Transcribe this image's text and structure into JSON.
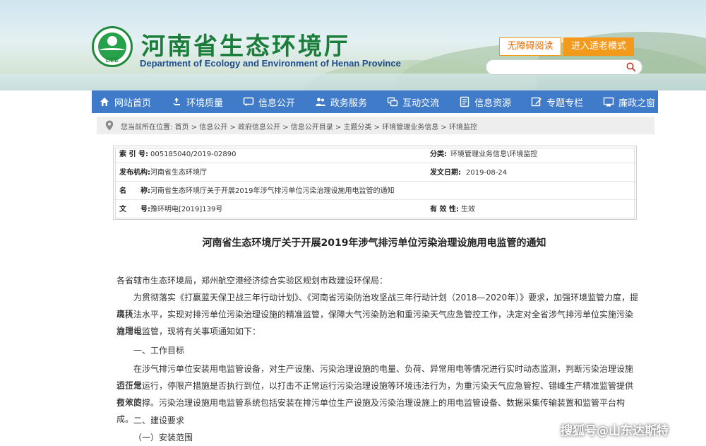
{
  "header": {
    "title": "河南省生态环境厅",
    "subtitle": "Department of Ecology and Environment of Henan Province",
    "logo_text": "DEE",
    "accessible_label": "无障碍阅读",
    "elder_mode_label": "进入适老模式",
    "search_placeholder": ""
  },
  "nav": {
    "items": [
      {
        "label": "网站首页",
        "icon": "home-icon"
      },
      {
        "label": "环境质量",
        "icon": "recycle-icon"
      },
      {
        "label": "信息公开",
        "icon": "chat-icon"
      },
      {
        "label": "政务服务",
        "icon": "people-icon"
      },
      {
        "label": "互动交流",
        "icon": "exchange-icon"
      },
      {
        "label": "信息资源",
        "icon": "database-icon"
      },
      {
        "label": "专题专栏",
        "icon": "edit-icon"
      },
      {
        "label": "廉政之窗",
        "icon": "window-icon"
      }
    ]
  },
  "breadcrumb": {
    "text": "您当前所在位置: 首页 > 信息公开 > 政府信息公开 > 信息公开目录 > 主题分类 > 环境管理业务信息 > 环境监控"
  },
  "info": {
    "index_label": "索 引 号:",
    "index_value": "005185040/2019-02890",
    "category_label": "分类:",
    "category_value": "环境管理业务信息\\环境监控",
    "publisher_label": "发布机构:",
    "publisher_value": "河南省生态环境厅",
    "date_label": "发文日期:",
    "date_value": "2019-08-24",
    "name_label": "名　　称:",
    "name_value": "河南省生态环境厅关于开展2019年涉气排污单位污染治理设施用电监管的通知",
    "doc_label": "文　　号:",
    "doc_value": "豫环明电[2019]139号",
    "validity_label": "有 效 性:",
    "validity_value": "生效"
  },
  "article": {
    "title": "河南省生态环境厅关于开展2019年涉气排污单位污染治理设施用电监管的通知",
    "salutation": "各省辖市生态环境局，郑州航空港经济综合实验区规划市政建设环保局：",
    "p1_line1": "为贯彻落实《打赢蓝天保卫战三年行动计划》、《河南省污染防治攻坚战三年行动计划（2018—2020年）》要求，加强环境监管力度，提高环",
    "p1_line2": "境执法水平，实现对排污单位污染治理设施的精准监管，保障大气污染防治和重污染天气应急管控工作，决定对全省涉气排污单位实施污染治理设",
    "p1_line3": "施用电监管，现将有关事项通知如下：",
    "h1": "一、工作目标",
    "p2_line1": "在涉气排污单位安装用电监管设备，对生产设施、污染治理设施的电量、负荷、异常用电等情况进行实时动态监测，判断污染治理设施运行是",
    "p2_line2": "否正常运行，停限产措施是否执行到位，以打击不正常运行污染治理设施等环境违法行为，为重污染天气应急管控、错峰生产精准监管提供有效的",
    "p2_line3": "技术支撑。污染治理设施用电监管系统包括安装在排污单位生产设施及污染治理设施上的用电监管设备、数据采集传输装置和监管平台构成。",
    "h2": "二、建设要求",
    "h3": "（一）安装范围"
  },
  "watermark": "搜狐号@山东达斯特",
  "colors": {
    "nav_bg": "#3f7bc8",
    "title_green": "#1b7d3a",
    "subtitle_blue": "#1e4c8f",
    "accent_orange": "#f39a1c"
  }
}
